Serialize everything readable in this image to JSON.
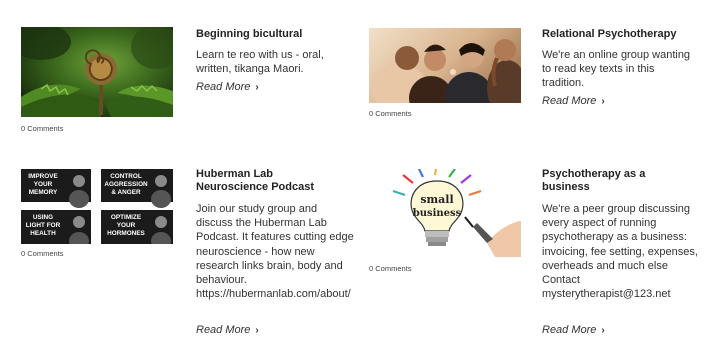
{
  "posts": [
    {
      "title": "Beginning bicultural",
      "description": "Learn te reo with us - oral, written, tikanga Maori.",
      "read_more": "Read More",
      "comments": "0 Comments"
    },
    {
      "title": "Relational Psychotherapy",
      "description": "We're an online group wanting to read key texts in this tradition.",
      "read_more": "Read More",
      "comments": "0 Comments"
    },
    {
      "title": "Huberman Lab Neuroscience Podcast",
      "description": "Join our study group and discuss the Huberman Lab Podcast. It features cutting edge neuroscience - how new research links brain, body and behaviour. https://hubermanlab.com/about/",
      "read_more": "Read More",
      "comments": "0 Comments",
      "thumb_tiles": [
        [
          "IMPROVE",
          "YOUR",
          "MEMORY"
        ],
        [
          "CONTROL",
          "AGGRESSION",
          "& ANGER"
        ],
        [
          "USING",
          "LIGHT FOR",
          "HEALTH"
        ],
        [
          "OPTIMIZE",
          "YOUR",
          "HORMONES"
        ]
      ]
    },
    {
      "title": "Psychotherapy as a business",
      "description": "We're a peer group discussing every aspect of running psychotherapy as a business: invoicing, fee setting, expenses, overheads and much else Contact mysterytherapist@123.net",
      "read_more": "Read More",
      "comments": "0 Comments",
      "thumb_words": [
        "small",
        "business"
      ]
    }
  ]
}
